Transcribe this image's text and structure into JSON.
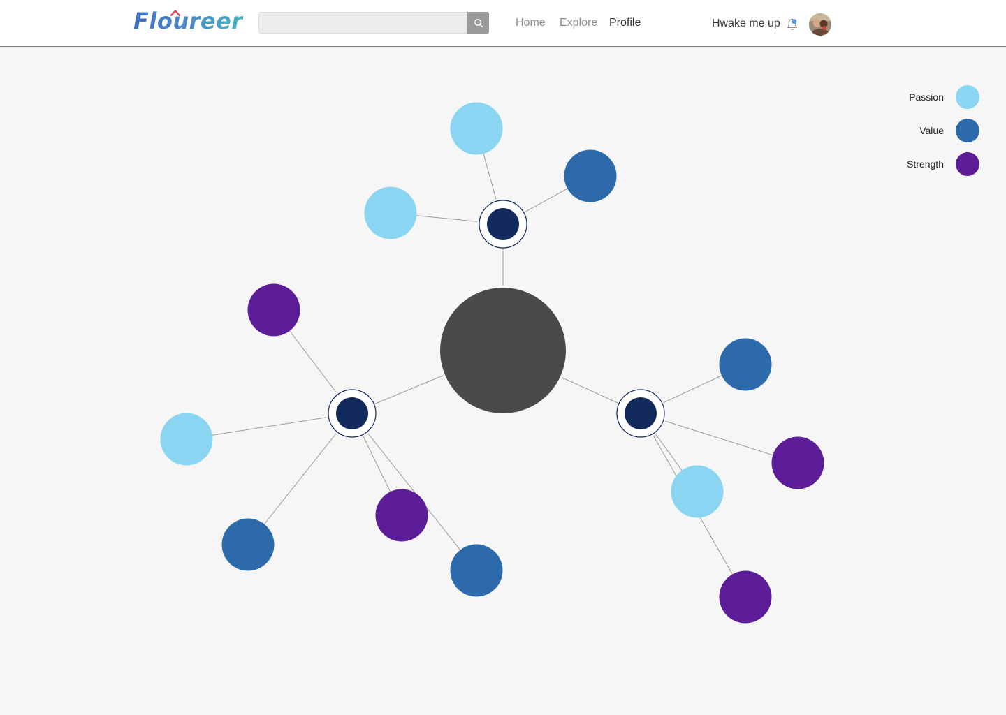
{
  "header": {
    "logo_text": "Floureer",
    "search": {
      "placeholder": "",
      "value": ""
    },
    "nav": [
      {
        "label": "Home",
        "active": false
      },
      {
        "label": "Explore",
        "active": false
      },
      {
        "label": "Profile",
        "active": true
      }
    ],
    "wake_label": "Hwake me up",
    "icons": [
      "search-icon",
      "bell-icon",
      "avatar"
    ]
  },
  "legend": [
    {
      "label": "Passion",
      "color": "#8ad5f1"
    },
    {
      "label": "Value",
      "color": "#2d6aab"
    },
    {
      "label": "Strength",
      "color": "#5d1c98"
    }
  ],
  "colors": {
    "center": "#4a4a4a",
    "hub": "#122a5c",
    "passion": "#8ad5f1",
    "value": "#2d6aab",
    "strength": "#5d1c98",
    "edge": "#9a9a9a",
    "accent": "#e0465a"
  },
  "graph": {
    "nodes": [
      {
        "id": "center",
        "kind": "center"
      },
      {
        "id": "hub-top",
        "kind": "hub"
      },
      {
        "id": "hub-left",
        "kind": "hub"
      },
      {
        "id": "hub-right",
        "kind": "hub"
      },
      {
        "id": "t1",
        "kind": "passion"
      },
      {
        "id": "t2",
        "kind": "passion"
      },
      {
        "id": "t3",
        "kind": "value"
      },
      {
        "id": "l1",
        "kind": "strength"
      },
      {
        "id": "l2",
        "kind": "passion"
      },
      {
        "id": "l3",
        "kind": "value"
      },
      {
        "id": "l4",
        "kind": "strength"
      },
      {
        "id": "l5",
        "kind": "value"
      },
      {
        "id": "r1",
        "kind": "value"
      },
      {
        "id": "r2",
        "kind": "strength"
      },
      {
        "id": "r3",
        "kind": "passion"
      },
      {
        "id": "r4",
        "kind": "strength"
      }
    ],
    "edges": [
      [
        "center",
        "hub-top"
      ],
      [
        "center",
        "hub-left"
      ],
      [
        "center",
        "hub-right"
      ],
      [
        "hub-top",
        "t1"
      ],
      [
        "hub-top",
        "t2"
      ],
      [
        "hub-top",
        "t3"
      ],
      [
        "hub-left",
        "l1"
      ],
      [
        "hub-left",
        "l2"
      ],
      [
        "hub-left",
        "l3"
      ],
      [
        "hub-left",
        "l4"
      ],
      [
        "hub-left",
        "l5"
      ],
      [
        "hub-right",
        "r1"
      ],
      [
        "hub-right",
        "r2"
      ],
      [
        "hub-right",
        "r3"
      ],
      [
        "hub-right",
        "r4"
      ]
    ]
  }
}
